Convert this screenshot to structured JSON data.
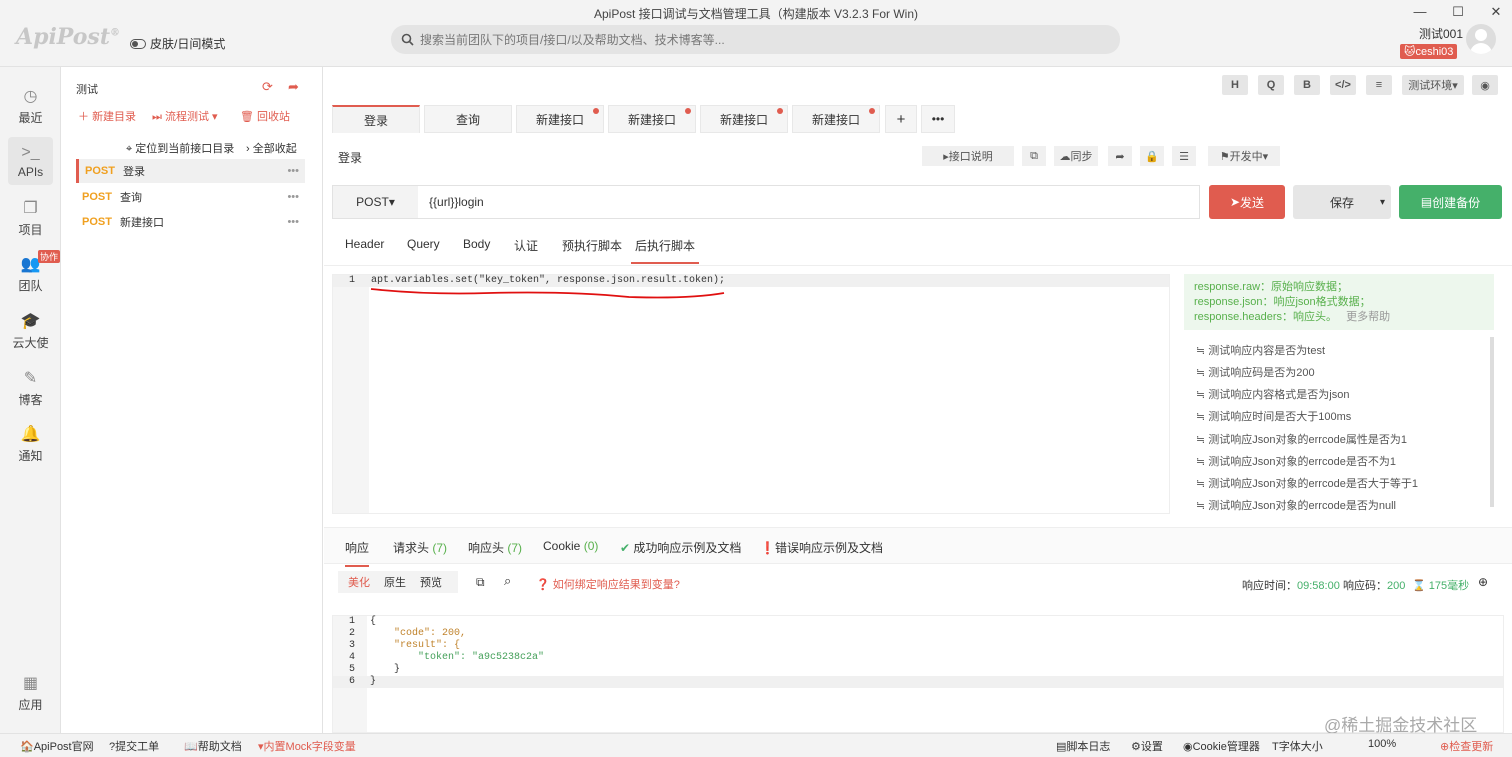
{
  "window": {
    "title": "ApiPost 接口调试与文档管理工具（构建版本 V3.2.3 For Win)"
  },
  "header": {
    "logo": "ApiPost",
    "skin_mode": "皮肤/日间模式",
    "search_placeholder": "搜索当前团队下的项目/接口/以及帮助文档、技术博客等...",
    "user_name": "测试001",
    "user_badge": "ceshi03"
  },
  "leftnav": {
    "items": [
      {
        "label": "最近",
        "icon": "clock-icon"
      },
      {
        "label": "APIs",
        "icon": "terminal-icon"
      },
      {
        "label": "项目",
        "icon": "project-icon"
      },
      {
        "label": "团队",
        "icon": "team-icon",
        "badge": "协作"
      },
      {
        "label": "云大使",
        "icon": "graduation-cap-icon"
      },
      {
        "label": "博客",
        "icon": "edit-icon"
      },
      {
        "label": "通知",
        "icon": "bell-icon"
      },
      {
        "label": "应用",
        "icon": "apps-grid-icon"
      }
    ]
  },
  "tree": {
    "project": "测试",
    "new_dir": "新建目录",
    "flow_test": "流程测试",
    "recycle": "回收站",
    "locate": "定位到当前接口目录",
    "collapse": "全部收起",
    "items": [
      {
        "method": "POST",
        "name": "登录"
      },
      {
        "method": "POST",
        "name": "查询"
      },
      {
        "method": "POST",
        "name": "新建接口"
      }
    ]
  },
  "toolbar": {
    "h": "H",
    "q": "Q",
    "b": "B",
    "code": "</>",
    "sliders": "≡",
    "env": "测试环境",
    "eye": "◉"
  },
  "tabs": [
    {
      "label": "登录"
    },
    {
      "label": "查询"
    },
    {
      "label": "新建接口"
    },
    {
      "label": "新建接口"
    },
    {
      "label": "新建接口"
    },
    {
      "label": "新建接口"
    }
  ],
  "request": {
    "name": "登录",
    "doc_btn": "接口说明",
    "sync_btn": "同步",
    "status": "开发中",
    "method": "POST",
    "url": "{{url}}login",
    "send": "发送",
    "save": "保存",
    "backup": "创建备份"
  },
  "subtabs": [
    "Header",
    "Query",
    "Body",
    "认证",
    "预执行脚本",
    "后执行脚本"
  ],
  "editor": {
    "line_no": "1",
    "code": "apt.variables.set(\"key_token\", response.json.result.token);"
  },
  "hint": {
    "lines": [
      "response.raw：原始响应数据；",
      "response.json：响应json格式数据；",
      "response.headers：响应头。"
    ],
    "more": "更多帮助"
  },
  "snippets": [
    "测试响应内容是否为test",
    "测试响应码是否为200",
    "测试响应内容格式是否为json",
    "测试响应时间是否大于100ms",
    "测试响应Json对象的errcode属性是否为1",
    "测试响应Json对象的errcode是否不为1",
    "测试响应Json对象的errcode是否大于等于1",
    "测试响应Json对象的errcode是否为null"
  ],
  "response": {
    "tabs": {
      "resp": "响应",
      "req_headers": "请求头",
      "req_headers_count": "(7)",
      "resp_headers": "响应头",
      "resp_headers_count": "(7)",
      "cookie": "Cookie",
      "cookie_count": "(0)",
      "success_doc": "成功响应示例及文档",
      "error_doc": "错误响应示例及文档"
    },
    "views": [
      "美化",
      "原生",
      "预览"
    ],
    "bind_help": "如何绑定响应结果到变量?",
    "time_label": "响应时间：",
    "time": "09:58:00",
    "code_label": "响应码：",
    "code": "200",
    "duration": "175毫秒",
    "body_lines": [
      {
        "n": "1",
        "t": "{"
      },
      {
        "n": "2",
        "t": "    \"code\": 200,"
      },
      {
        "n": "3",
        "t": "    \"result\": {"
      },
      {
        "n": "4",
        "t": "        \"token\": \"a9c5238c2a\""
      },
      {
        "n": "5",
        "t": "    }"
      },
      {
        "n": "6",
        "t": "}"
      }
    ]
  },
  "statusbar": {
    "site": "ApiPost官网",
    "ticket": "提交工单",
    "help": "帮助文档",
    "mock": "内置Mock字段变量",
    "log": "脚本日志",
    "settings": "设置",
    "cookie_mgr": "Cookie管理器",
    "font": "字体大小",
    "zoom": "100%",
    "update": "检查更新"
  },
  "watermark": "@稀土掘金技术社区"
}
